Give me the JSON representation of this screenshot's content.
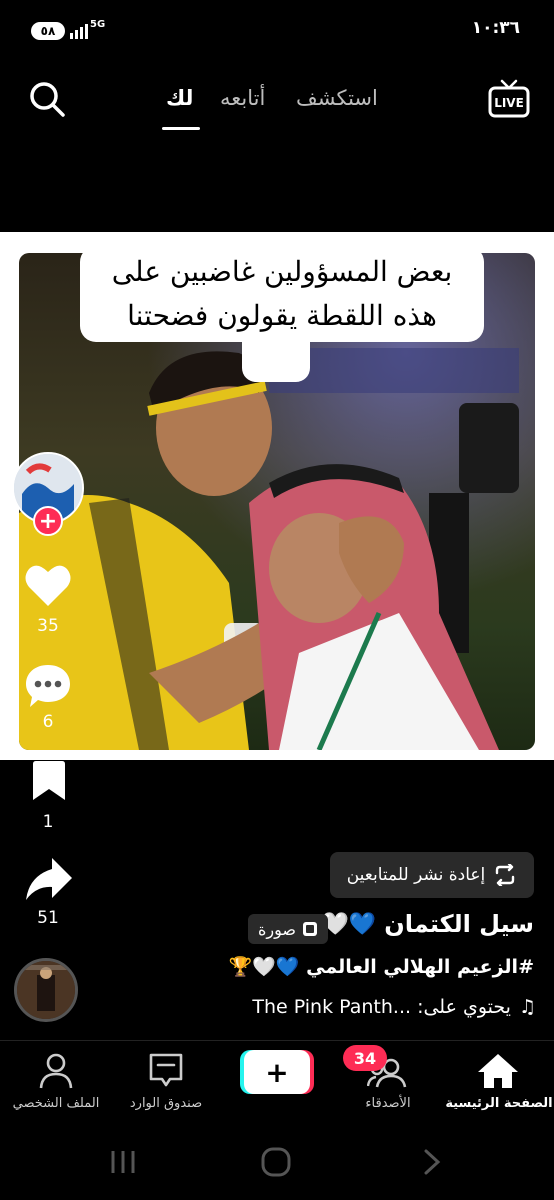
{
  "status": {
    "time": "١٠:٣٦",
    "battery": "٥٨",
    "network": "5G"
  },
  "top_nav": {
    "tab_for_you": "لك",
    "tab_following": "أتابعه",
    "tab_explore": "استكشف",
    "live_label": "LIVE"
  },
  "post": {
    "caption_line1": "بعض المسؤولين غاضبين على",
    "caption_line2": "هذه اللقطة يقولون فضحتنا",
    "caption_emoji": "😂",
    "likes": "35",
    "comments": "6",
    "saves": "1",
    "shares": "51",
    "repost_label": "إعادة نشر للمتابعين",
    "username": "سيل الكتمان",
    "username_hearts": "💙🤍",
    "photo_tag": "صورة",
    "hashtag_line": "#الزعيم الهلالي العالمي 💙🤍🏆",
    "music_line": "يحتوي على: ...The Pink Panth"
  },
  "tabbar": {
    "home": "الصفحة الرئيسية",
    "friends": "الأصدقاء",
    "friends_badge": "34",
    "inbox": "صندوق الوارد",
    "profile": "الملف الشخصي"
  },
  "colors": {
    "accent_red": "#fe2c55",
    "accent_cyan": "#25f4ee"
  }
}
